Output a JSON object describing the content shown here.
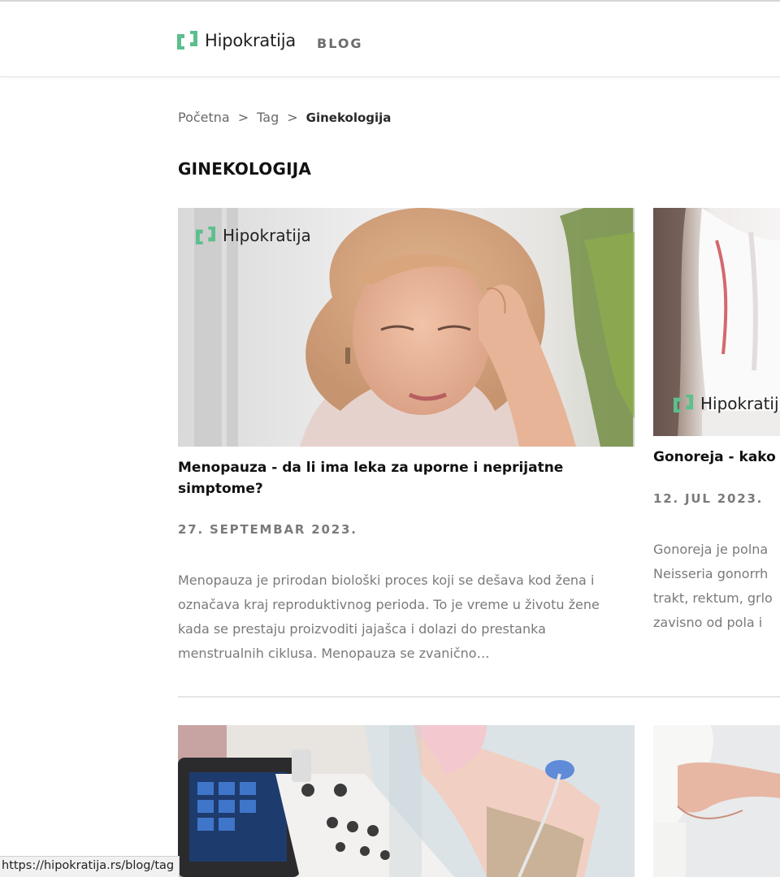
{
  "header": {
    "brand": "Hipokratija",
    "section": "BLOG"
  },
  "colors": {
    "brand_green": "#5cbf8e",
    "accent_gray": "#6d6d6d"
  },
  "breadcrumb": {
    "home": "Početna",
    "separator": ">",
    "tag": "Tag",
    "current": "Ginekologija"
  },
  "page": {
    "title": "GINEKOLOGIJA"
  },
  "posts": [
    {
      "image_brand": "Hipokratija",
      "title": "Menopauza - da li ima leka za uporne i neprijatne simptome?",
      "date": "27. SEPTEMBAR 2023.",
      "excerpt": "Menopauza je prirodan biološki proces koji se dešava kod žena i označava kraj reproduktivnog perioda. To je vreme u životu žene kada se prestaju proizvoditi jajašca i dolazi do prestanka menstrualnih ciklusa. Menopauza se zvanično…"
    },
    {
      "image_brand": "Hipokratij",
      "title": "Gonoreja - kako",
      "date": "12. JUL 2023.",
      "excerpt_lines": [
        "Gonoreja je polna",
        "Neisseria gonorrh",
        "trakt, rektum, grlo",
        "zavisno od pola i"
      ]
    }
  ],
  "status_bar": {
    "url": "https://hipokratija.rs/blog/tag"
  }
}
